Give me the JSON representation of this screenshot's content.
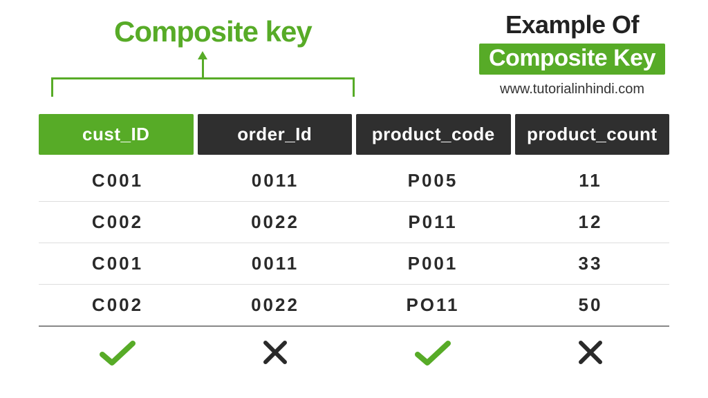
{
  "labels": {
    "composite_key_title": "Composite key",
    "example_of": "Example Of",
    "composite_key_badge": "Composite Key",
    "website": "www.tutorialinhindi.com"
  },
  "table": {
    "headers": [
      {
        "text": "cust_ID",
        "is_key": true
      },
      {
        "text": "order_Id",
        "is_key": false
      },
      {
        "text": "product_code",
        "is_key": false
      },
      {
        "text": "product_count",
        "is_key": false
      }
    ],
    "rows": [
      {
        "cust_id": "C001",
        "order_id": "0011",
        "product_code": "P005",
        "product_count": "11"
      },
      {
        "cust_id": "C002",
        "order_id": "0022",
        "product_code": "P011",
        "product_count": "12"
      },
      {
        "cust_id": "C001",
        "order_id": "0011",
        "product_code": "P001",
        "product_count": "33"
      },
      {
        "cust_id": "C002",
        "order_id": "0022",
        "product_code": "PO11",
        "product_count": "50"
      }
    ],
    "column_status": [
      "check",
      "cross",
      "check",
      "cross"
    ]
  }
}
